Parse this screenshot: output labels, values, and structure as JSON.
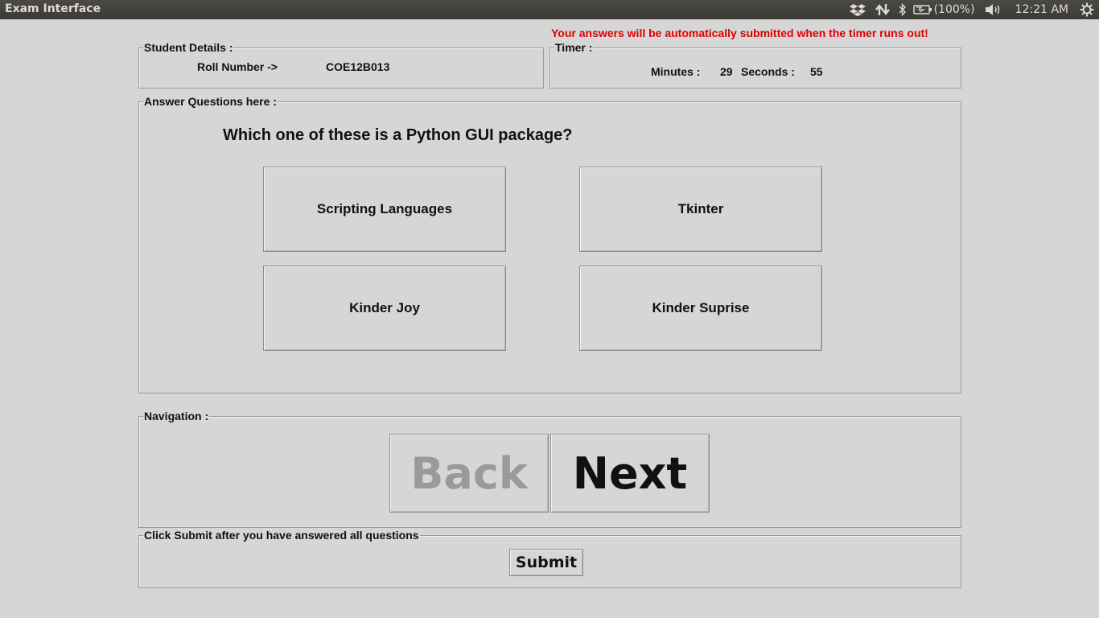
{
  "window": {
    "title": "Exam Interface"
  },
  "tray": {
    "battery": "(100%)",
    "clock": "12:21 AM"
  },
  "warning": "Your answers will be automatically submitted when the timer runs out!",
  "student": {
    "legend": "Student Details :",
    "roll_label": "Roll Number ->",
    "roll_value": "COE12B013"
  },
  "timer": {
    "legend": "Timer :",
    "minutes_label": "Minutes :",
    "minutes_value": "29",
    "seconds_label": "Seconds :",
    "seconds_value": "55"
  },
  "answers": {
    "legend": "Answer Questions here :",
    "question": "Which one of these is a Python GUI package?",
    "options": [
      "Scripting Languages",
      "Tkinter",
      "Kinder Joy",
      "Kinder Suprise"
    ]
  },
  "navigation": {
    "legend": "Navigation :",
    "back_label": "Back",
    "next_label": "Next"
  },
  "submit": {
    "legend": "Click Submit after you have answered all questions",
    "button_label": "Submit"
  },
  "colors": {
    "warning": "#e00000",
    "background": "#d6d6d6",
    "topbar": "#3c3b37",
    "disabled_text": "#9a9a9a"
  }
}
